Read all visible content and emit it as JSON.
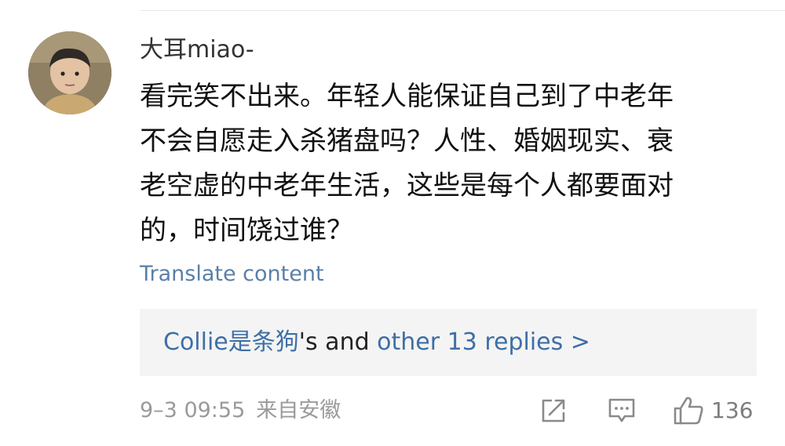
{
  "comment": {
    "username": "大耳miao-",
    "lines": [
      "看完笑不出来。年轻人能保证自己到了中老年",
      "不会自愿走入杀猪盘吗？人性、婚姻现实、衰",
      "老空虚的中老年生活，这些是每个人都要面对",
      "的，时间饶过谁？"
    ],
    "translate_label": "Translate content"
  },
  "replies": {
    "first_replier": "Collie是条狗",
    "connector": "'s and ",
    "more_label": "other 13 replies >"
  },
  "footer": {
    "timestamp": "9–3 09:55",
    "location": "来自安徽",
    "like_count": "136"
  },
  "icons": {
    "share": "share-icon",
    "comment": "comment-icon",
    "like": "thumbs-up-icon"
  }
}
